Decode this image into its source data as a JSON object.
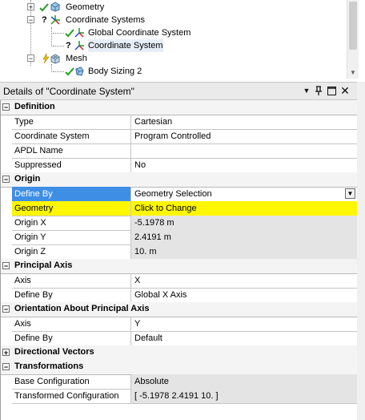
{
  "tree": {
    "nodes": [
      {
        "label": "Geometry",
        "status": "check",
        "icon": "geometry-icon"
      },
      {
        "label": "Coordinate Systems",
        "status": "question",
        "icon": "coordinate-systems-icon"
      },
      {
        "label": "Global Coordinate System",
        "status": "check",
        "icon": "axis-icon"
      },
      {
        "label": "Coordinate System",
        "status": "question",
        "icon": "axis-icon"
      },
      {
        "label": "Mesh",
        "status": "lightning",
        "icon": "mesh-icon"
      },
      {
        "label": "Body Sizing 2",
        "status": "check",
        "icon": "sizing-icon"
      }
    ]
  },
  "details": {
    "title": "Details of \"Coordinate System\"",
    "groups": [
      {
        "label": "Definition",
        "rows": [
          {
            "key": "Type",
            "value": "Cartesian"
          },
          {
            "key": "Coordinate System",
            "value": "Program Controlled"
          },
          {
            "key": "APDL Name",
            "value": ""
          },
          {
            "key": "Suppressed",
            "value": "No"
          }
        ]
      },
      {
        "label": "Origin",
        "rows": [
          {
            "key": "Define By",
            "value": "Geometry Selection"
          },
          {
            "key": "Geometry",
            "value": "Click to Change"
          },
          {
            "key": "Origin X",
            "value": "-5.1978 m"
          },
          {
            "key": "Origin Y",
            "value": "2.4191 m"
          },
          {
            "key": "Origin Z",
            "value": "10. m"
          }
        ]
      },
      {
        "label": "Principal Axis",
        "rows": [
          {
            "key": "Axis",
            "value": "X"
          },
          {
            "key": "Define By",
            "value": "Global X Axis"
          }
        ]
      },
      {
        "label": "Orientation About Principal Axis",
        "rows": [
          {
            "key": "Axis",
            "value": "Y"
          },
          {
            "key": "Define By",
            "value": "Default"
          }
        ]
      },
      {
        "label": "Directional Vectors",
        "rows": []
      },
      {
        "label": "Transformations",
        "rows": [
          {
            "key": "Base Configuration",
            "value": "Absolute"
          },
          {
            "key": "Transformed Configuration",
            "value": "[ -5.1978  2.4191  10.  ]"
          }
        ]
      }
    ]
  },
  "colors": {
    "selected_key": "#3f8ee6",
    "highlight_row": "#fff700",
    "readonly": "#e4e4e4"
  }
}
